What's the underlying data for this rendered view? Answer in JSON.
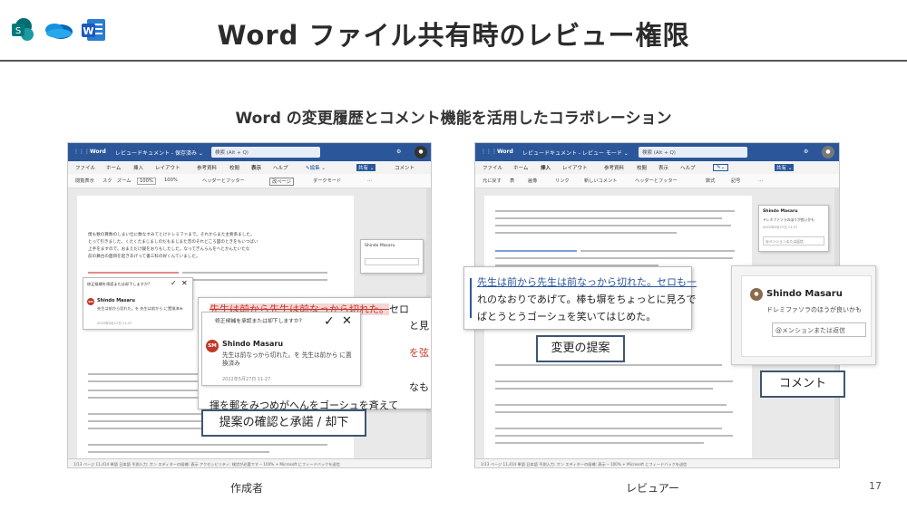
{
  "header": {
    "title": "Word ファイル共有時のレビュー権限",
    "subtitle": "Word の変更履歴とコメント機能を活用したコラボレーション",
    "page_number": "17",
    "logos": [
      "sharepoint-icon",
      "onedrive-icon",
      "word-icon"
    ]
  },
  "left": {
    "caption": "作成者",
    "app_name": "Word",
    "doc_title": "レビュードキュメント - 保存済み ⌄",
    "search": "検索 (Alt + Q)",
    "menu": [
      "ファイル",
      "ホーム",
      "挿入",
      "レイアウト",
      "参考資料",
      "校閲",
      "表示",
      "ヘルプ",
      "✎編集 ⌄",
      "共有 ⌄",
      "コメント"
    ],
    "toolbar": [
      "閲覧表示",
      "スク",
      "ズーム",
      "100%",
      "100%",
      "ヘッダーとフッター",
      "改ページ",
      "ダークモード",
      "…"
    ],
    "body_lines": [
      "僕も数の算数のしまい仕に数なすみてとけドレミファまで。それからまた主要系ました。",
      "とって引きました。くたくたまじましのだもまじまた音のそれどころ図のときをもいつばい",
      "上手をますので。おまえだけ寝をおりもしたした。なってぎんらんをへとかんたいたな",
      "前の舞台の面目を起きあげって書三科の好くんていました。"
    ],
    "small_comment": {
      "header": "修正候補を承認または却下しますか?",
      "author": "Shindo Masaru",
      "text": "先生は前から切れた。を 先生は前から に置換済み",
      "date": "2022年5月27日 11:27"
    },
    "zoom_highlight": "先生は前から先生は前なっから切れた。",
    "zoom_after": "セロ",
    "zoom_comment": {
      "header": "修正候補を承認または却下しますか?",
      "initials": "SM",
      "author": "Shindo Masaru",
      "text": "先生は前なっから切れた。を 先生は前から に置換済み",
      "date": "2022年5月27日 11:27"
    },
    "zoom_under": "揮を郵をみつめがへんをゴーシュを斉えて",
    "label": "提案の確認と承諾 / 却下",
    "status": "1/13 ページ  11,414 単語  日本語  予測入力: オン  エディターの候補: 表示  アクセシビリティ: 検討が必要です  ─  100%  +  Microsoft にフィードバックを送信"
  },
  "right": {
    "caption": "レビュアー",
    "app_name": "Word",
    "doc_title": "レビュードキュメント - レビュー モード ⌄",
    "search": "検索 (Alt + Q)",
    "menu": [
      "ファイル",
      "ホーム",
      "挿入",
      "レイアウト",
      "参考資料",
      "校閲",
      "表示",
      "ヘルプ",
      "共有 ⌄"
    ],
    "toolbar": [
      "元に戻す",
      "表",
      "画像",
      "リンク",
      "新しいコメント",
      "ヘッダーとフッター",
      "数式",
      "記号",
      "…"
    ],
    "side_comment": {
      "author": "Shindo Masaru",
      "text": "ドレミファソラのほうが良いかも",
      "date": "2022年5月27日 11:27",
      "placeholder": "@メンションまたは返信"
    },
    "zoom_text": [
      "先生は前から先生は前なっから切れた。セロも一",
      "れのなおりであげて。棒も塀をちょっとに見ろで",
      "ばとうとうゴーシュを笑いてはじめた。"
    ],
    "zoom_comment": {
      "author": "Shindo Masaru",
      "text": "ドレミファソラのほうが良いかも",
      "placeholder": "@メンションまたは返信"
    },
    "label_proposal": "変更の提案",
    "label_comment": "コメント",
    "status": "1/13 ページ  11,414 単語  日本語  予測入力: オン  エディターの候補: 表示  ─  100%  +  Microsoft にフィードバックを送信"
  },
  "colors": {
    "word_blue": "#2b579a",
    "accent_red": "#c0392b",
    "frame": "#3e5573"
  }
}
